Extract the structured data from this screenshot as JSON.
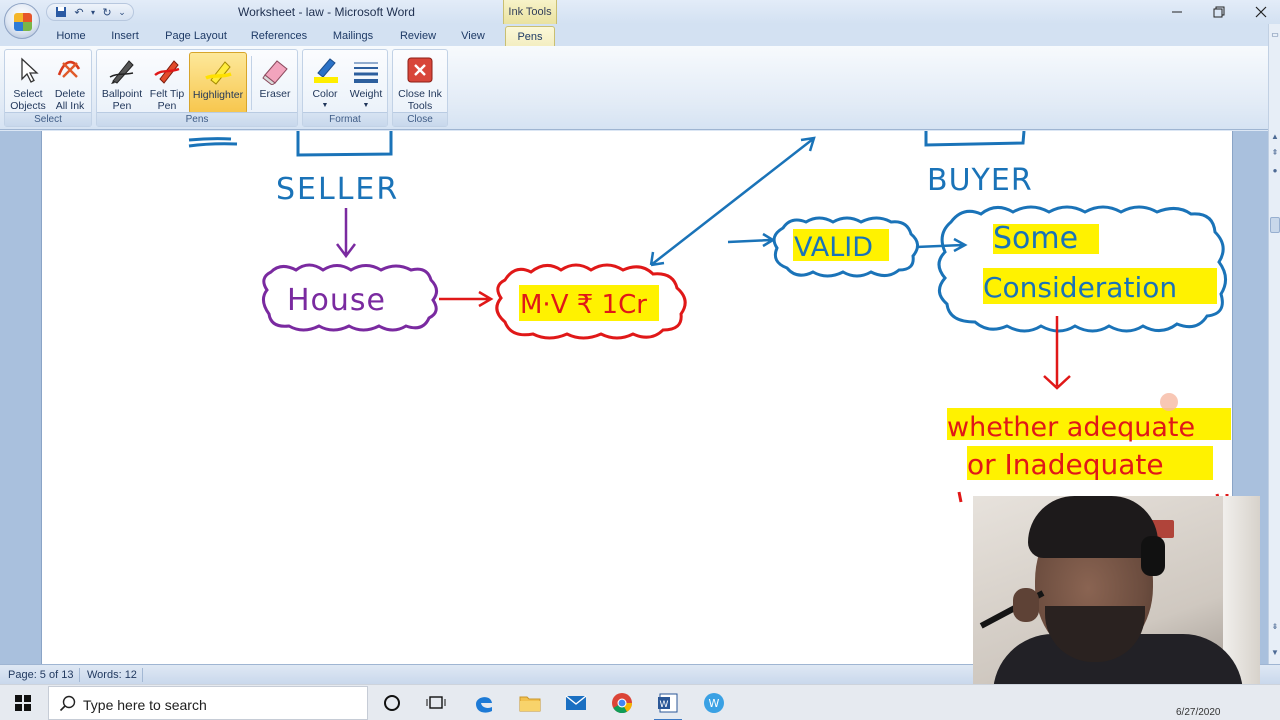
{
  "window": {
    "title": "Worksheet - law - Microsoft Word",
    "context_tab": "Ink Tools"
  },
  "qat": {
    "save_icon": "save-icon",
    "undo_icon": "undo-icon",
    "redo_icon": "redo-icon"
  },
  "tabs": [
    "Home",
    "Insert",
    "Page Layout",
    "References",
    "Mailings",
    "Review",
    "View",
    "Pens"
  ],
  "ribbon": {
    "select_group": {
      "label": "Select",
      "select_objects": "Select Objects",
      "delete_all_ink": "Delete All Ink"
    },
    "pens_group": {
      "label": "Pens",
      "ballpoint": "Ballpoint Pen",
      "felt_tip": "Felt Tip Pen",
      "highlighter": "Highlighter",
      "eraser": "Eraser"
    },
    "format_group": {
      "label": "Format",
      "color": "Color",
      "weight": "Weight"
    },
    "close_group": {
      "label": "Close",
      "close_ink": "Close Ink Tools"
    }
  },
  "document": {
    "ink": {
      "seller": "SELLER",
      "buyer": "BUYER",
      "house": "House",
      "mv": "M·V ₹ 1Cr",
      "valid": "VALID",
      "some": "Some",
      "consideration": "Consideration",
      "whether_adequate": "whether adequate",
      "or_inadequate": "or Inadequate"
    },
    "colors": {
      "blue_ink": "#1a73b8",
      "purple_ink": "#7a2aa0",
      "red_ink": "#e01818",
      "highlight": "#fff200"
    }
  },
  "statusbar": {
    "page": "Page: 5 of 13",
    "words": "Words: 12"
  },
  "taskbar": {
    "search_placeholder": "Type here to search",
    "date": "6/27/2020"
  }
}
